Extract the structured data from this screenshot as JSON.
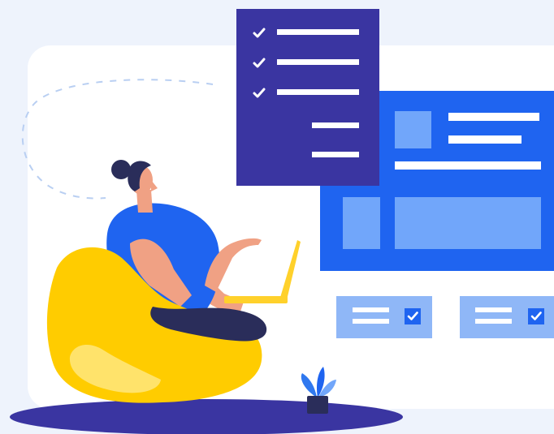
{
  "illustration": {
    "checklist_panel": {
      "items": [
        {
          "checked": true
        },
        {
          "checked": true
        },
        {
          "checked": true
        },
        {
          "checked": false
        },
        {
          "checked": false
        }
      ]
    },
    "mini_cards": [
      {
        "checked": true
      },
      {
        "checked": true
      }
    ],
    "colors": {
      "background": "#eef3fc",
      "backdrop_card": "#ffffff",
      "checklist_panel": "#3a35a1",
      "dashboard_panel": "#1f64f0",
      "dashboard_tiles": "#71a6fa",
      "mini_card": "#8fb7f7",
      "beanbag": "#ffcc00",
      "floor_shadow": "#3a35a1",
      "shirt": "#1f64f0",
      "skin": "#f0a184",
      "hair": "#2a2d5a",
      "laptop": "#ffd12b",
      "plant_leaves": "#2f78ef",
      "plant_pot": "#2a2d5a"
    }
  }
}
